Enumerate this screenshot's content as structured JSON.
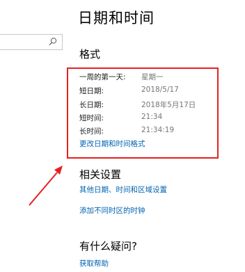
{
  "search": {
    "placeholder": ""
  },
  "page_title": "日期和时间",
  "format": {
    "heading": "格式",
    "rows": [
      {
        "label": "一周的第一天:",
        "value": "星期一"
      },
      {
        "label": "短日期:",
        "value": "2018/5/17"
      },
      {
        "label": "长日期:",
        "value": "2018年5月17日"
      },
      {
        "label": "短时间:",
        "value": "21:34"
      },
      {
        "label": "长时间:",
        "value": "21:34:19"
      }
    ],
    "change_link": "更改日期和时间格式"
  },
  "related": {
    "heading": "相关设置",
    "links": [
      "其他日期、时间和区域设置",
      "添加不同时区的时钟"
    ]
  },
  "help": {
    "heading": "有什么疑问?",
    "link": "获取帮助"
  },
  "colors": {
    "link": "#0063b1",
    "annotation": "#e5201f",
    "secondary_text": "#767676"
  }
}
